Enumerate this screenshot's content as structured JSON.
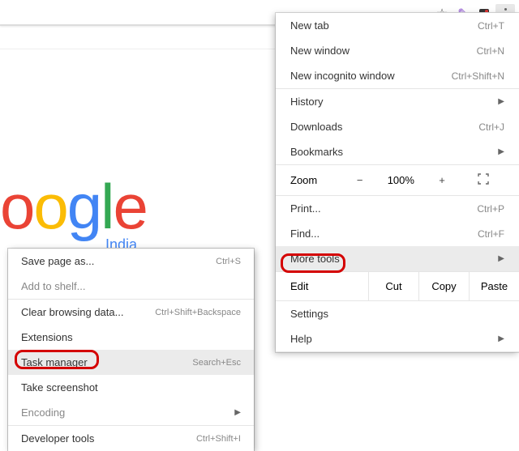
{
  "toolbar": {
    "star_icon": "star",
    "ext1_icon": "feather",
    "ext2_icon": "ext",
    "menu_icon": "dots"
  },
  "logo": {
    "o1": "o",
    "o2": "o",
    "g": "g",
    "l": "l",
    "e": "e",
    "sub": "India"
  },
  "menu": {
    "new_tab": {
      "label": "New tab",
      "shortcut": "Ctrl+T"
    },
    "new_window": {
      "label": "New window",
      "shortcut": "Ctrl+N"
    },
    "new_incognito": {
      "label": "New incognito window",
      "shortcut": "Ctrl+Shift+N"
    },
    "history": {
      "label": "History"
    },
    "downloads": {
      "label": "Downloads",
      "shortcut": "Ctrl+J"
    },
    "bookmarks": {
      "label": "Bookmarks"
    },
    "zoom": {
      "label": "Zoom",
      "minus": "−",
      "value": "100%",
      "plus": "+"
    },
    "print": {
      "label": "Print...",
      "shortcut": "Ctrl+P"
    },
    "find": {
      "label": "Find...",
      "shortcut": "Ctrl+F"
    },
    "more_tools": {
      "label": "More tools"
    },
    "edit": {
      "label": "Edit",
      "cut": "Cut",
      "copy": "Copy",
      "paste": "Paste"
    },
    "settings": {
      "label": "Settings"
    },
    "help": {
      "label": "Help"
    }
  },
  "submenu": {
    "save_page": {
      "label": "Save page as...",
      "shortcut": "Ctrl+S"
    },
    "add_shelf": {
      "label": "Add to shelf..."
    },
    "clear_data": {
      "label": "Clear browsing data...",
      "shortcut": "Ctrl+Shift+Backspace"
    },
    "extensions": {
      "label": "Extensions"
    },
    "task_manager": {
      "label": "Task manager",
      "shortcut": "Search+Esc"
    },
    "screenshot": {
      "label": "Take screenshot"
    },
    "encoding": {
      "label": "Encoding"
    },
    "devtools": {
      "label": "Developer tools",
      "shortcut": "Ctrl+Shift+I"
    }
  }
}
